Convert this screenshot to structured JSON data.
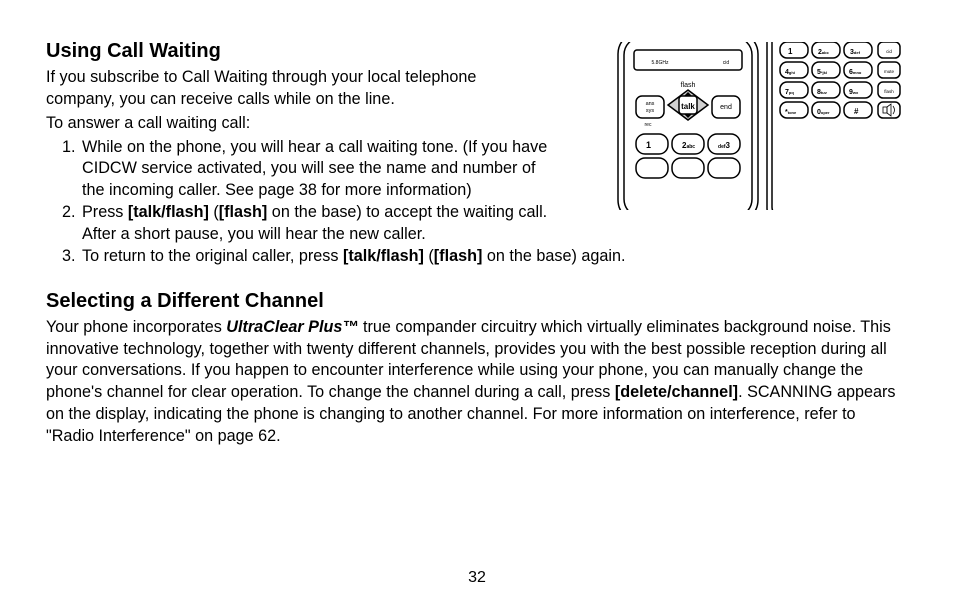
{
  "section1": {
    "heading": "Using Call Waiting",
    "intro1": "If you subscribe to Call Waiting through your local telephone company, you can receive calls while on the line.",
    "intro2": "To answer a call waiting call:",
    "steps": {
      "s1": "While on the phone, you will hear a call waiting tone. (If you have CIDCW service activated, you will see the name and number of the incoming caller. See page 38 for more information)",
      "s2a": "Press ",
      "s2b": "[talk/flash]",
      "s2c": " (",
      "s2d": "[flash]",
      "s2e": " on the base) to accept the waiting call. After a short pause, you will hear the new caller.",
      "s3a": "To return to the original caller, press ",
      "s3b": "[talk/flash]",
      "s3c": " (",
      "s3d": "[flash]",
      "s3e": " on the base) again."
    }
  },
  "section2": {
    "heading": "Selecting a Different Channel",
    "p1a": "Your phone incorporates ",
    "p1b": "UltraClear Plus™",
    "p1c": " true compander circuitry which virtually eliminates background noise. This innovative technology, together with twenty different channels, provides you with the best possible reception during all your conversations. If you happen to encounter interference while using your phone, you can manually change the phone's channel for clear operation. To change the channel during a call, press ",
    "p1d": "[delete/channel]",
    "p1e": ". SCANNING appears on the display, indicating the phone is changing to another channel. For more information on interference, refer to \"Radio Interference\" on page 62."
  },
  "illustration": {
    "handset": {
      "talk": "talk",
      "end": "end",
      "ans_sys": "ans sys",
      "flash": "flash",
      "band": "5.8GHz",
      "cid": "cid",
      "rec": "rec",
      "k1": "1",
      "k2": "2abc",
      "k3": "3"
    },
    "base": {
      "k1": "1",
      "k2": "2abc",
      "k3": "3def",
      "k4": "4ghi",
      "k5": "5*jkl",
      "k6": "6mno",
      "k7": "7pqrs",
      "k8": "8tuv",
      "k9": "9wxyz",
      "kstar": "*tone",
      "k0": "0oper",
      "khash": "#",
      "side1": "cid",
      "side2": "mute",
      "side3": "flash",
      "side4": "speaker"
    }
  },
  "page_number": "32"
}
